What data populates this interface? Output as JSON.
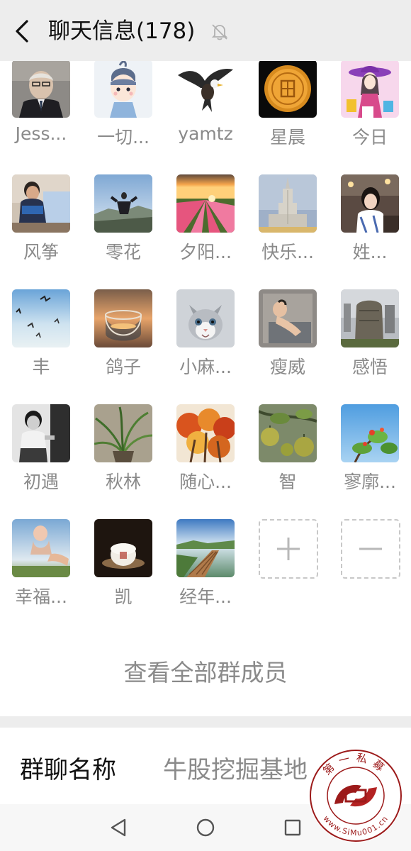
{
  "header": {
    "title": "聊天信息(178)"
  },
  "members": [
    {
      "name": "Jess...",
      "avatar": "portrait-old-man"
    },
    {
      "name": "一切...",
      "avatar": "cartoon-child"
    },
    {
      "name": "yamtz",
      "avatar": "eagle"
    },
    {
      "name": "星晨",
      "avatar": "gold-coin"
    },
    {
      "name": "今日",
      "avatar": "cartoon-shopping-girl"
    },
    {
      "name": "风筝",
      "avatar": "boy-reading"
    },
    {
      "name": "零花",
      "avatar": "man-on-hill"
    },
    {
      "name": "夕阳...",
      "avatar": "flower-field-sunset"
    },
    {
      "name": "快乐...",
      "avatar": "tower-building"
    },
    {
      "name": "姓...",
      "avatar": "woman-portrait"
    },
    {
      "name": "丰",
      "avatar": "birds-over-sea"
    },
    {
      "name": "鸽子",
      "avatar": "glass-bowl-sunset"
    },
    {
      "name": "小麻...",
      "avatar": "kitten"
    },
    {
      "name": "瘦威",
      "avatar": "sleeping-baby"
    },
    {
      "name": "感悟",
      "avatar": "stone-monument"
    },
    {
      "name": "初遇",
      "avatar": "old-photo-child"
    },
    {
      "name": "秋林",
      "avatar": "potted-plant"
    },
    {
      "name": "随心...",
      "avatar": "autumn-trees"
    },
    {
      "name": "智",
      "avatar": "green-fruits"
    },
    {
      "name": "寥廓...",
      "avatar": "red-tree-blue-sky"
    },
    {
      "name": "幸福...",
      "avatar": "hand-art"
    },
    {
      "name": "凯",
      "avatar": "tea-cake"
    },
    {
      "name": "经年...",
      "avatar": "boardwalk-lake"
    }
  ],
  "add_button": {
    "icon": "plus-icon"
  },
  "remove_button": {
    "icon": "minus-icon"
  },
  "view_all_label": "查看全部群成员",
  "group_name": {
    "label": "群聊名称",
    "value": "牛股挖掘基地"
  },
  "watermark": {
    "top_text": "第一私募",
    "url_text": "www.SiMu001.cn"
  }
}
